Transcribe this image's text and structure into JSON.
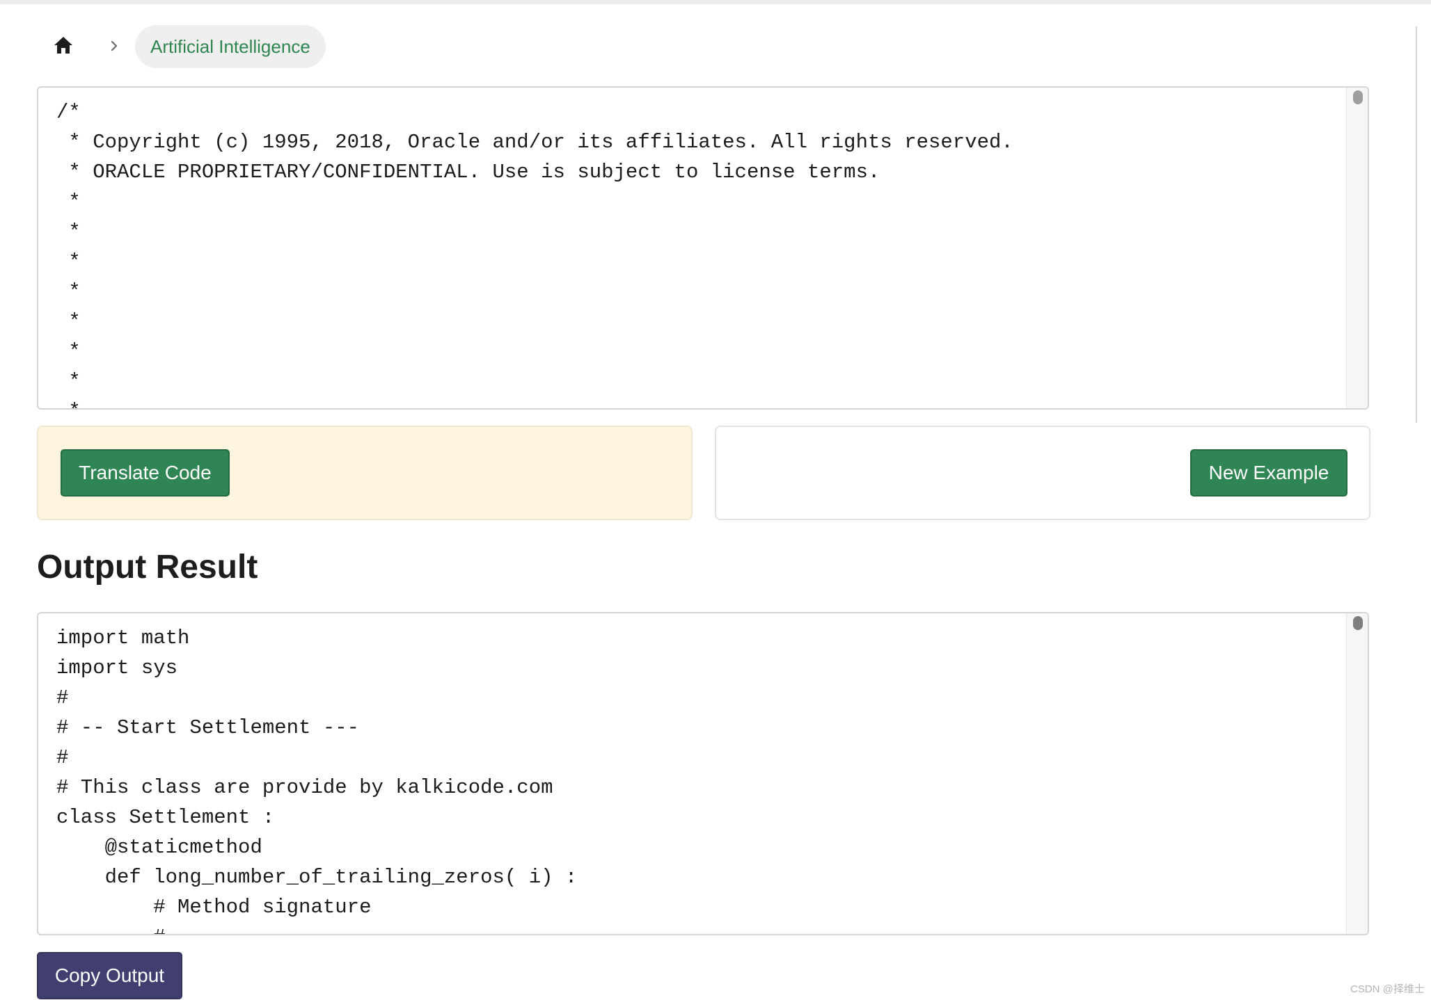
{
  "breadcrumb": {
    "home_icon": "home-icon",
    "separator_icon": "chevron-right-icon",
    "current": "Artificial Intelligence"
  },
  "source_code": {
    "lines": [
      "/*",
      " * Copyright (c) 1995, 2018, Oracle and/or its affiliates. All rights reserved.",
      " * ORACLE PROPRIETARY/CONFIDENTIAL. Use is subject to license terms.",
      " *",
      " *",
      " *",
      " *",
      " *",
      " *",
      " *",
      " *"
    ]
  },
  "actions": {
    "translate_label": "Translate Code",
    "new_example_label": "New Example"
  },
  "output": {
    "title": "Output Result",
    "lines": [
      "import math",
      "import sys",
      "#",
      "# -- Start Settlement ---",
      "#",
      "# This class are provide by kalkicode.com",
      "class Settlement :",
      "    @staticmethod",
      "    def long_number_of_trailing_zeros( i) :",
      "        # Method signature",
      "        #"
    ],
    "copy_label": "Copy Output"
  },
  "watermark": "CSDN @择维士",
  "colors": {
    "accent_green": "#2f8553",
    "breadcrumb_text": "#2f8650",
    "copy_button": "#403f6f",
    "translate_panel_bg": "#fdf5dd"
  }
}
